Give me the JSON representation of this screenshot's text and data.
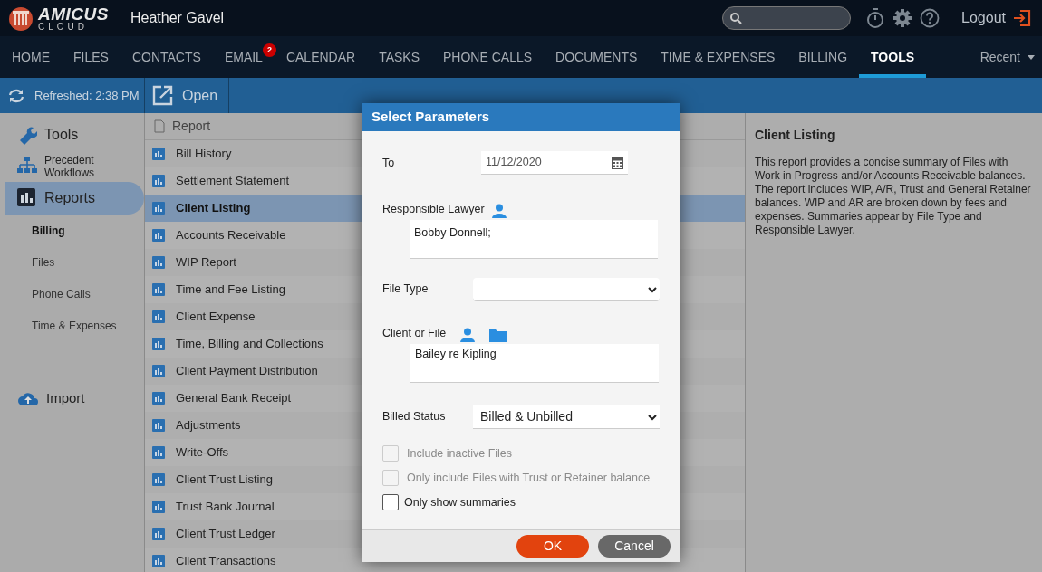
{
  "header": {
    "logo_word": "AMICUS",
    "logo_sub": "CLOUD",
    "user": "Heather Gavel",
    "logout": "Logout"
  },
  "nav": {
    "items": [
      {
        "label": "HOME",
        "selected": false
      },
      {
        "label": "FILES",
        "selected": false
      },
      {
        "label": "CONTACTS",
        "selected": false
      },
      {
        "label": "EMAIL",
        "selected": false,
        "badge": "2"
      },
      {
        "label": "CALENDAR",
        "selected": false
      },
      {
        "label": "TASKS",
        "selected": false
      },
      {
        "label": "PHONE CALLS",
        "selected": false
      },
      {
        "label": "DOCUMENTS",
        "selected": false
      },
      {
        "label": "TIME & EXPENSES",
        "selected": false
      },
      {
        "label": "BILLING",
        "selected": false
      },
      {
        "label": "TOOLS",
        "selected": true
      }
    ],
    "recent": "Recent"
  },
  "toolbar": {
    "refreshed": "Refreshed: 2:38 PM",
    "open": "Open"
  },
  "sidebar": {
    "items": [
      {
        "label": "Tools",
        "kind": "main",
        "selected": false
      },
      {
        "label": "Precedent Workflows",
        "kind": "small",
        "selected": false
      },
      {
        "label": "Reports",
        "kind": "main",
        "selected": true
      },
      {
        "label": "Billing",
        "kind": "sub",
        "selected": true
      },
      {
        "label": "Files",
        "kind": "sub",
        "selected": false
      },
      {
        "label": "Phone Calls",
        "kind": "sub",
        "selected": false
      },
      {
        "label": "Time & Expenses",
        "kind": "sub",
        "selected": false
      }
    ],
    "import": "Import"
  },
  "reports": {
    "header": "Report",
    "rows": [
      {
        "label": "Bill History",
        "selected": false
      },
      {
        "label": "Settlement Statement",
        "selected": false
      },
      {
        "label": "Client Listing",
        "selected": true
      },
      {
        "label": "Accounts Receivable",
        "selected": false
      },
      {
        "label": "WIP Report",
        "selected": false
      },
      {
        "label": "Time and Fee Listing",
        "selected": false
      },
      {
        "label": "Client Expense",
        "selected": false
      },
      {
        "label": "Time, Billing and Collections",
        "selected": false
      },
      {
        "label": "Client Payment Distribution",
        "selected": false
      },
      {
        "label": "General Bank Receipt",
        "selected": false
      },
      {
        "label": "Adjustments",
        "selected": false
      },
      {
        "label": "Write-Offs",
        "selected": false
      },
      {
        "label": "Client Trust Listing",
        "selected": false
      },
      {
        "label": "Trust Bank Journal",
        "selected": false
      },
      {
        "label": "Client Trust Ledger",
        "selected": false
      },
      {
        "label": "Client Transactions",
        "selected": false
      }
    ]
  },
  "details": {
    "title": "Client Listing",
    "text": "This report provides a concise summary of Files with Work in Progress and/or Accounts Receivable balances. The report includes WIP, A/R, Trust and General Retainer balances. WIP and AR are broken down by fees and expenses. Summaries appear by File Type and Responsible Lawyer."
  },
  "dialog": {
    "title": "Select Parameters",
    "to": {
      "label": "To",
      "value": "11/12/2020"
    },
    "lawyer": {
      "label": "Responsible Lawyer",
      "value": "Bobby Donnell;"
    },
    "file_type": {
      "label": "File Type"
    },
    "client_file": {
      "label": "Client or File",
      "value": "Bailey re Kipling"
    },
    "billed_status": {
      "label": "Billed Status",
      "value": "Billed & Unbilled"
    },
    "checkboxes": [
      {
        "label": "Include inactive Files",
        "checked": false,
        "disabled": true
      },
      {
        "label": "Only include Files with Trust or Retainer balance",
        "checked": false,
        "disabled": true
      },
      {
        "label": "Only show summaries",
        "checked": false,
        "disabled": false
      }
    ],
    "buttons": [
      {
        "label": "OK",
        "kind": "primary"
      },
      {
        "label": "Cancel",
        "kind": "secondary"
      }
    ]
  }
}
